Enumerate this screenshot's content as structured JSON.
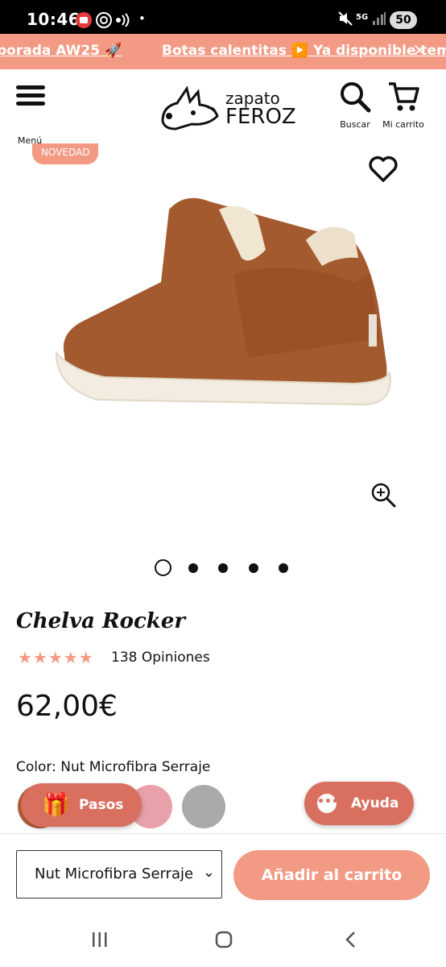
{
  "status_bar": {
    "time": "10:46",
    "battery": "50",
    "network": "5G"
  },
  "promo": {
    "text1": "porada AW25 🚀",
    "text2": "Botas calentitas ▶️ Ya disponible temp",
    "close_icon": "×"
  },
  "header": {
    "menu_label": "Menú",
    "logo_line1": "zapato",
    "logo_line2": "FEROZ",
    "search_label": "Buscar",
    "cart_label": "Mi carrito"
  },
  "product": {
    "badge": "NOVEDAD",
    "title": "Chelva Rocker",
    "rating_stars": "★★★★★",
    "rating": 5,
    "reviews": "138 Opiniones",
    "price": "62,00€",
    "color_label": "Color:",
    "color_value": " Nut Microfibra Serraje",
    "carousel_total": 5,
    "carousel_active": 1
  },
  "swatches": [
    {
      "name": "brown",
      "color": "#b5633a"
    },
    {
      "name": "pink",
      "color": "#e8a0aa"
    },
    {
      "name": "grey",
      "color": "#a8aba8"
    }
  ],
  "floating": {
    "pasos_label": "Pasos",
    "ayuda_label": "Ayuda"
  },
  "purchase": {
    "select_value": "Nut Microfibra Serraje",
    "add_to_cart": "Añadir al carrito"
  },
  "colors": {
    "accent": "#f29a84",
    "floating": "#d9705f"
  }
}
